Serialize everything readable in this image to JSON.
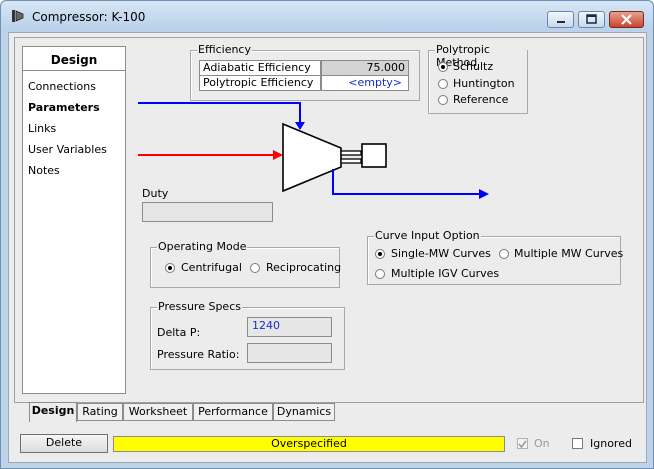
{
  "window": {
    "title": "Compressor: K-100"
  },
  "nav": {
    "heading": "Design",
    "items": [
      {
        "label": "Connections",
        "selected": false
      },
      {
        "label": "Parameters",
        "selected": true
      },
      {
        "label": "Links",
        "selected": false
      },
      {
        "label": "User Variables",
        "selected": false
      },
      {
        "label": "Notes",
        "selected": false
      }
    ]
  },
  "efficiency": {
    "title": "Efficiency",
    "rows": [
      {
        "label": "Adiabatic Efficiency",
        "value": "75.000"
      },
      {
        "label": "Polytropic Efficiency",
        "value": "<empty>"
      }
    ]
  },
  "polytropic_method": {
    "title": "Polytropic Method",
    "options": [
      {
        "label": "Schultz",
        "selected": true
      },
      {
        "label": "Huntington",
        "selected": false
      },
      {
        "label": "Reference",
        "selected": false
      }
    ]
  },
  "duty": {
    "label": "Duty",
    "value": ""
  },
  "operating_mode": {
    "title": "Operating Mode",
    "options": [
      {
        "label": "Centrifugal",
        "selected": true
      },
      {
        "label": "Reciprocating",
        "selected": false
      }
    ]
  },
  "curve_input": {
    "title": "Curve Input Option",
    "options": [
      {
        "label": "Single-MW Curves",
        "selected": true
      },
      {
        "label": "Multiple MW Curves",
        "selected": false
      },
      {
        "label": "Multiple IGV Curves",
        "selected": false
      }
    ]
  },
  "pressure_specs": {
    "title": "Pressure Specs",
    "delta_p_label": "Delta P:",
    "delta_p_value": "1240",
    "ratio_label": "Pressure Ratio:",
    "ratio_value": ""
  },
  "tabs": [
    {
      "label": "Design",
      "active": true
    },
    {
      "label": "Rating",
      "active": false
    },
    {
      "label": "Worksheet",
      "active": false
    },
    {
      "label": "Performance",
      "active": false
    },
    {
      "label": "Dynamics",
      "active": false
    }
  ],
  "footer": {
    "delete_label": "Delete",
    "status_text": "Overspecified",
    "status_color": "#ffff00",
    "on_label": "On",
    "on_checked": true,
    "ignored_label": "Ignored",
    "ignored_checked": false
  },
  "colors": {
    "energy_stream": "#0000ff",
    "feed_stream": "#ff0000",
    "value_text": "#1a2ec8"
  },
  "icons": [
    "compressor-app-icon",
    "minimize-icon",
    "restore-icon",
    "close-icon",
    "compressor-unit-icon"
  ]
}
